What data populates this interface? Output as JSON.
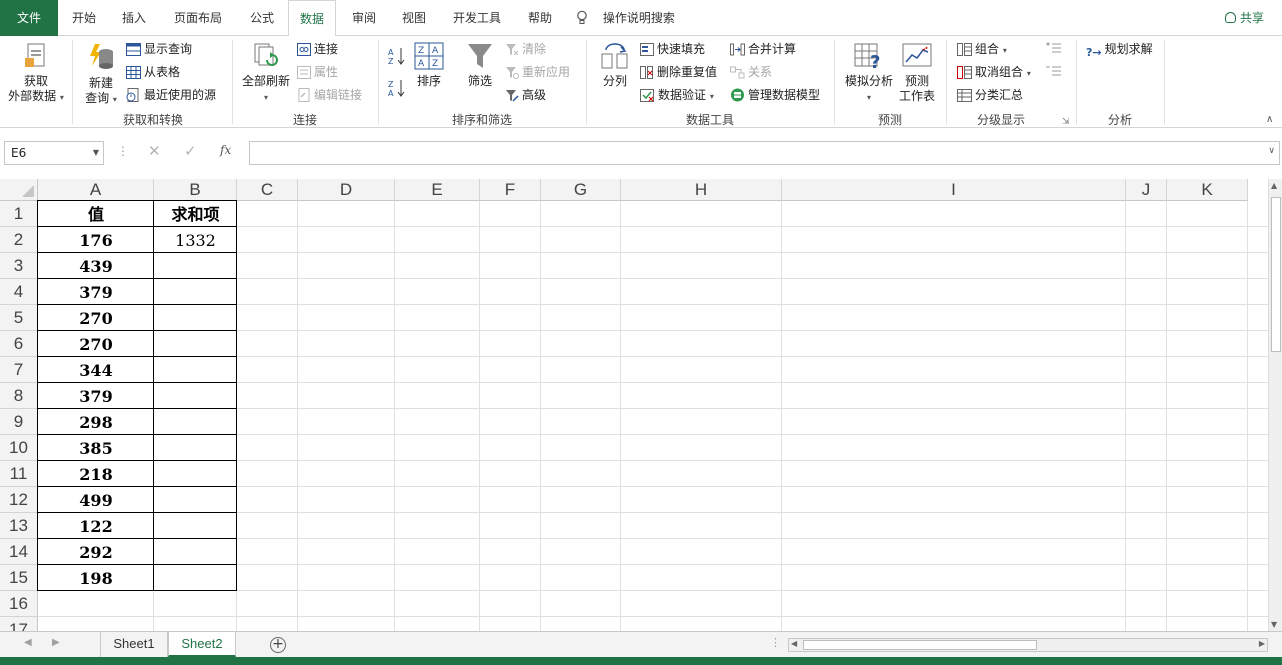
{
  "ribbon_tabs": [
    "文件",
    "开始",
    "插入",
    "页面布局",
    "公式",
    "数据",
    "审阅",
    "视图",
    "开发工具",
    "帮助"
  ],
  "active_tab": "数据",
  "tell_me": "操作说明搜索",
  "share": "共享",
  "groups": {
    "get_transform": {
      "label": "获取和转换",
      "get_external": [
        "获取",
        "外部数据"
      ],
      "new_query": [
        "新建",
        "查询"
      ],
      "show_queries": "显示查询",
      "from_table": "从表格",
      "recent_sources": "最近使用的源"
    },
    "connections": {
      "label": "连接",
      "refresh_all": "全部刷新",
      "connections": "连接",
      "properties": "属性",
      "edit_links": "编辑链接"
    },
    "sort_filter": {
      "label": "排序和筛选",
      "sort": "排序",
      "filter": "筛选",
      "clear": "清除",
      "reapply": "重新应用",
      "advanced": "高级"
    },
    "data_tools": {
      "label": "数据工具",
      "text_to_columns": "分列",
      "flash_fill": "快速填充",
      "remove_duplicates": "删除重复值",
      "data_validation": "数据验证",
      "consolidate": "合并计算",
      "relationships": "关系",
      "manage_model": "管理数据模型"
    },
    "forecast": {
      "label": "预测",
      "what_if": "模拟分析",
      "forecast_sheet": [
        "预测",
        "工作表"
      ]
    },
    "outline": {
      "label": "分级显示",
      "group": "组合",
      "ungroup": "取消组合",
      "subtotal": "分类汇总"
    },
    "analysis": {
      "label": "分析",
      "solver": "规划求解"
    }
  },
  "name_box": "E6",
  "formula": "",
  "columns": [
    "A",
    "B",
    "C",
    "D",
    "E",
    "F",
    "G",
    "H",
    "I",
    "J",
    "K"
  ],
  "rows": [
    "1",
    "2",
    "3",
    "4",
    "5",
    "6",
    "7",
    "8",
    "9",
    "10",
    "11",
    "12",
    "13",
    "14",
    "15",
    "16",
    "17"
  ],
  "headers": {
    "A": "值",
    "B": "求和项"
  },
  "values_A": [
    "176",
    "439",
    "379",
    "270",
    "270",
    "344",
    "379",
    "298",
    "385",
    "218",
    "499",
    "122",
    "292",
    "198"
  ],
  "sum_B": "1332",
  "sheets": [
    "Sheet1",
    "Sheet2"
  ],
  "active_sheet": "Sheet2",
  "accent_color": "#217346"
}
